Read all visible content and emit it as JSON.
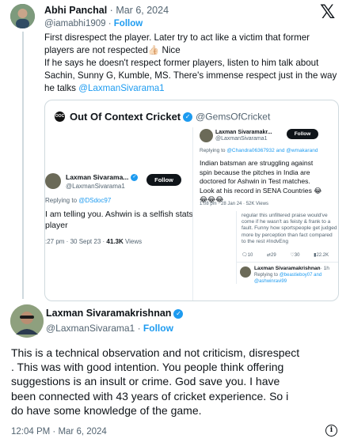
{
  "top_tweet": {
    "name": "Abhi Panchal",
    "date": "Mar 6, 2024",
    "handle": "@iamabhi1909",
    "follow": "Follow",
    "text_lines": [
      "First disrespect the player. Later try to act like a victim that former",
      "players are not respected👍🏻 Nice",
      "If he says he doesn't respect former players, listen to him talk about",
      "Sachin, Sunny G, Kumble, MS. There's immense respect just in the way",
      "he talks "
    ],
    "mention": "@LaxmanSivarama1"
  },
  "embedded": {
    "logo_text": "OOC",
    "account_name": "Out Of Context Cricket",
    "account_handle": "@GemsOfCricket",
    "shot_left": {
      "name": "Laxman Sivarama...",
      "handle": "@LaxmanSivarama1",
      "follow": "Follow",
      "reply_prefix": "Replying to ",
      "reply_mention": "@DSdoc97",
      "body_lines": [
        "I am telling you. Ashwin is a selfish stats",
        "player"
      ],
      "meta": ":27 pm · 30 Sept 23 · ",
      "views_count": "41.3K",
      "views_label": " Views"
    },
    "shot_right": {
      "name": "Laxman Sivaramakr...",
      "handle": "@LaxmanSivarama1",
      "follow": "Follow",
      "reply_prefix": "Replying to ",
      "reply_mention": "@Chandra06367932 and @wmakarand",
      "body_lines": [
        "Indian batsman are struggling against",
        "spin because the pitches in India are",
        "doctored for Ashwin in Test matches.",
        "Look at his record in SENA Countries 😂",
        "😂😂😂"
      ],
      "meta": "1:08 pm · 28 Jan 24 · 52K Views",
      "quote_lines": [
        "regular this unfiltered praise would've",
        "come if he wasn't as feisty & frank to a",
        "fault. Funny how sportspeople get judged",
        "more by perception than fact compared",
        "to the rest #IndvEng"
      ],
      "quote_stats": [
        "10",
        "29",
        "30",
        "22.2K"
      ],
      "reply_name": "Laxman Sivaramakrishnan",
      "reply_meta": "· 1h",
      "reply_to_prefix": "Replying to ",
      "reply_to_1": "@beastieboy07 and",
      "reply_to_2": "@ashwinravi99"
    }
  },
  "main_tweet": {
    "name": "Laxman Sivaramakrishnan",
    "handle": "@LaxmanSivarama1",
    "follow": "Follow",
    "body_lines": [
      "This is a technical observation and not criticism, disrespect",
      ". This was with good intention. You people think offering",
      "suggestions is an insult or crime. God save you. I have",
      "been connected with 43 years of cricket experience. So i",
      "do have some knowledge of the game."
    ],
    "timestamp": "12:04 PM · Mar 6, 2024"
  },
  "colors": {
    "link": "#1d9bf0",
    "secondary": "#536471",
    "text": "#0f1419"
  }
}
